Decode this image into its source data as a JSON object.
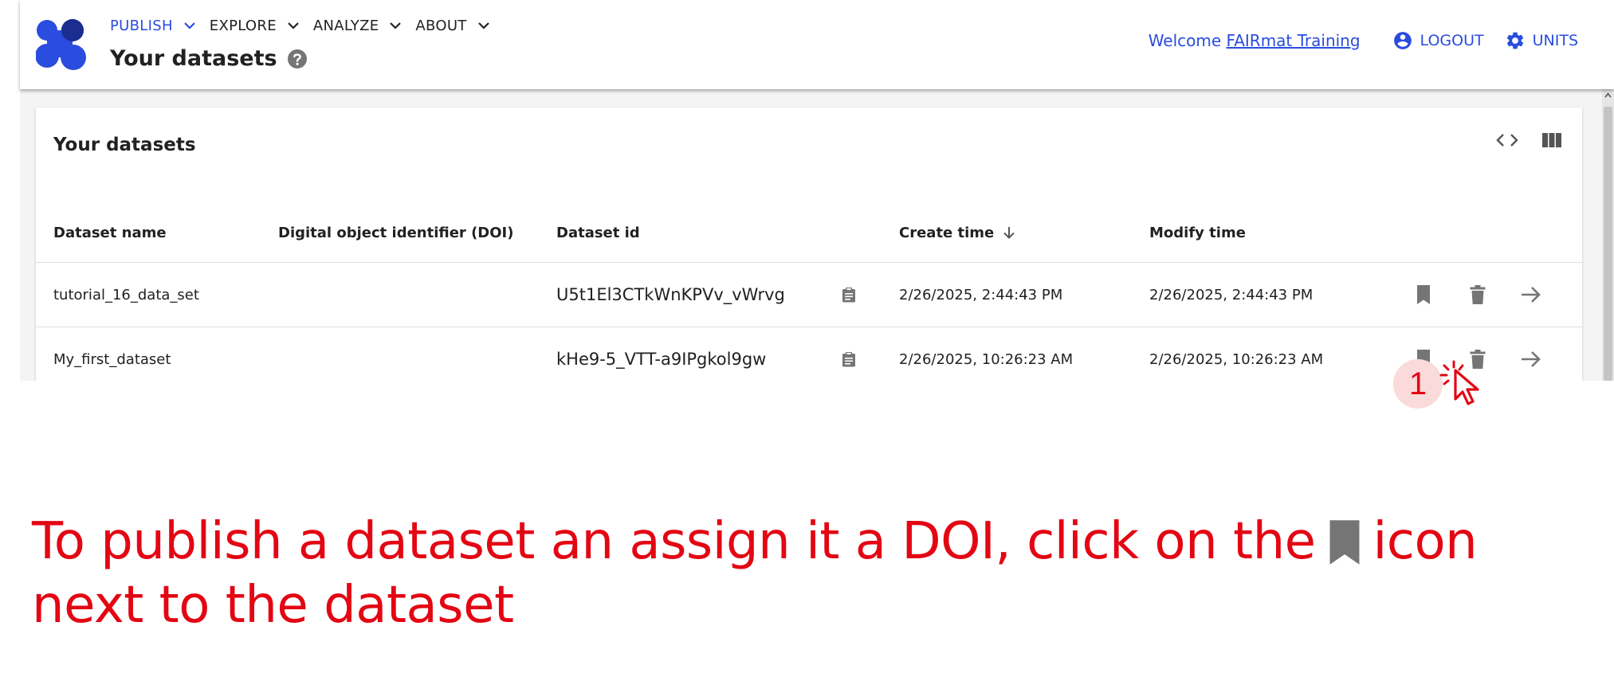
{
  "header": {
    "nav": [
      {
        "label": "PUBLISH",
        "active": true
      },
      {
        "label": "EXPLORE",
        "active": false
      },
      {
        "label": "ANALYZE",
        "active": false
      },
      {
        "label": "ABOUT",
        "active": false
      }
    ],
    "page_title": "Your datasets",
    "welcome_prefix": "Welcome ",
    "user_name": "FAIRmat Training",
    "logout_label": "LOGOUT",
    "units_label": "UNITS"
  },
  "card": {
    "title": "Your datasets",
    "columns": [
      "Dataset name",
      "Digital object identifier (DOI)",
      "Dataset id",
      "Create time",
      "Modify time"
    ],
    "rows": [
      {
        "name": "tutorial_16_data_set",
        "doi": "",
        "id": "U5t1El3CTkWnKPVv_vWrvg",
        "create": "2/26/2025, 2:44:43 PM",
        "modify": "2/26/2025, 2:44:43 PM"
      },
      {
        "name": "My_first_dataset",
        "doi": "",
        "id": "kHe9-5_VTT-a9IPgkol9gw",
        "create": "2/26/2025, 10:26:23 AM",
        "modify": "2/26/2025, 10:26:23 AM"
      }
    ]
  },
  "annotation": {
    "step_number": "1",
    "instruction_before": "To publish a dataset an assign it a DOI, click on the",
    "instruction_after": "icon next to the dataset"
  },
  "colors": {
    "brand_blue": "#2a4cdf",
    "annotation_red": "#e30613",
    "icon_gray": "#757575"
  }
}
